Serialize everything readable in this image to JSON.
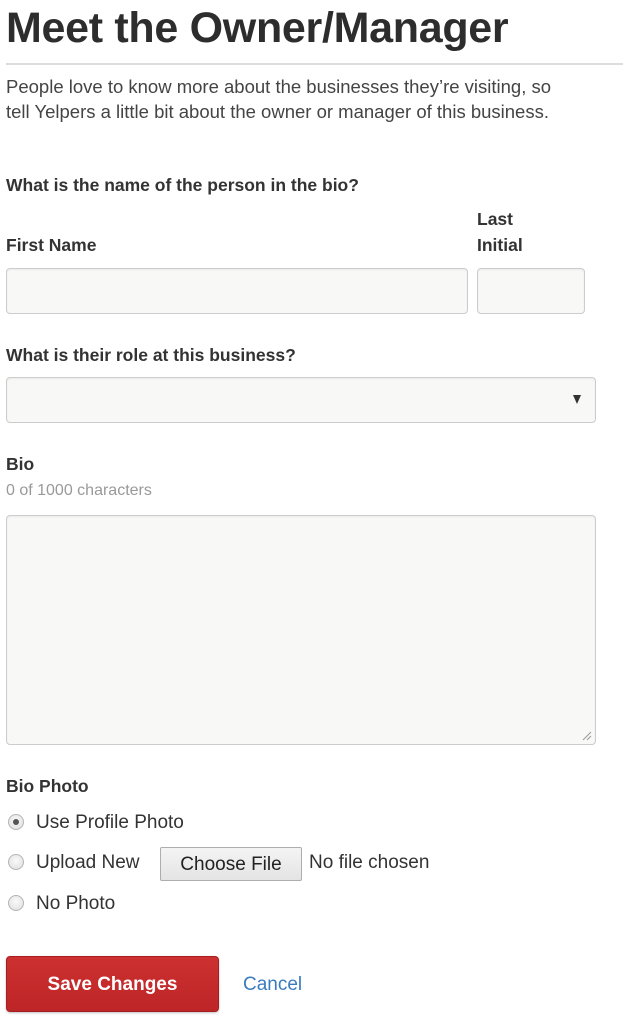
{
  "page": {
    "title": "Meet the Owner/Manager",
    "intro": "People love to know more about the businesses they’re visiting, so tell Yelpers a little bit about the owner or manager of this business."
  },
  "name_section": {
    "question": "What is the name of the person in the bio?",
    "first_name": {
      "label": "First Name",
      "value": "",
      "placeholder": ""
    },
    "last_initial": {
      "label_line1": "Last",
      "label_line2": "Initial",
      "value": "",
      "placeholder": ""
    }
  },
  "role_section": {
    "question": "What is their role at this business?",
    "selected_value": ""
  },
  "bio_section": {
    "label": "Bio",
    "char_count": "0 of 1000 characters",
    "value": ""
  },
  "photo_section": {
    "label": "Bio Photo",
    "options": [
      {
        "label": "Use Profile Photo",
        "checked": true
      },
      {
        "label": "Upload New",
        "checked": false
      },
      {
        "label": "No Photo",
        "checked": false
      }
    ],
    "file_button_label": "Choose File",
    "file_status": "No file chosen"
  },
  "actions": {
    "save_label": "Save Changes",
    "cancel_label": "Cancel"
  },
  "colors": {
    "primary_button": "#c4282a",
    "link": "#3b7bbf"
  }
}
